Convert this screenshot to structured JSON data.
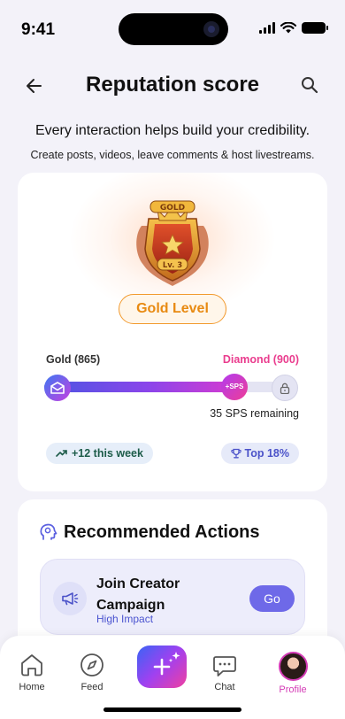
{
  "status_bar": {
    "time": "9:41"
  },
  "header": {
    "title": "Reputation score"
  },
  "intro": {
    "headline": "Every interaction helps build your credibility.",
    "subline": "Create posts, videos, leave comments & host livestreams."
  },
  "level_card": {
    "badge": {
      "top_text": "GOLD",
      "level_text": "Lv. 3"
    },
    "level_label": "Gold Level",
    "progress": {
      "current_label": "Gold (865)",
      "next_label": "Diamond (900)",
      "current_value": 865,
      "target_value": 900,
      "fraction": 0.75,
      "marker_label": "+SPS",
      "remaining_text": "35 SPS remaining"
    },
    "weekly_chip": "+12 this week",
    "rank_chip": "Top 18%"
  },
  "recommended": {
    "title": "Recommended Actions",
    "actions": [
      {
        "title": "Join Creator Campaign",
        "impact": "High Impact",
        "button": "Go"
      }
    ]
  },
  "bottom_nav": {
    "items": [
      {
        "label": "Home"
      },
      {
        "label": "Feed"
      },
      {
        "label": "Chat"
      },
      {
        "label": "Profile"
      }
    ]
  },
  "colors": {
    "accent_pink": "#ea3d8e",
    "accent_purple": "#6e69e8",
    "gold": "#e88a12",
    "active_nav": "#d43bb6"
  }
}
